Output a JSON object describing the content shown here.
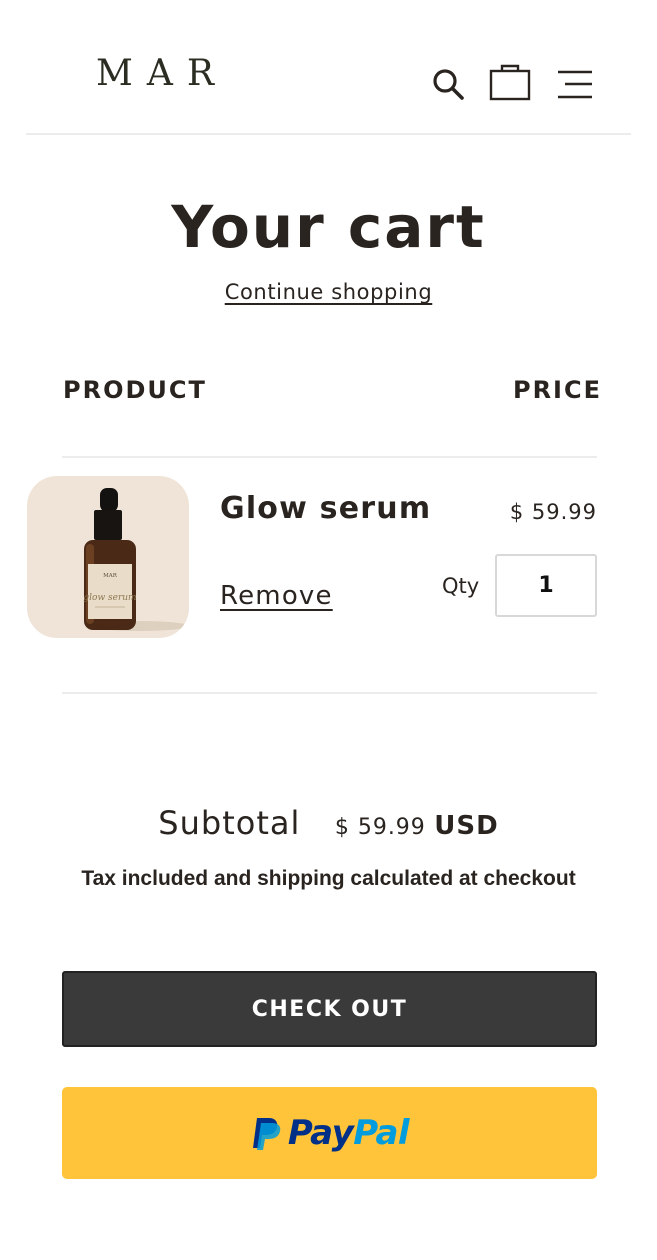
{
  "header": {
    "logo": "MAR",
    "icons": [
      "search-icon",
      "shopping-bag-icon",
      "menu-icon"
    ]
  },
  "cart": {
    "title": "Your cart",
    "continue_label": "Continue shopping",
    "columns": {
      "product": "PRODUCT",
      "price": "PRICE"
    },
    "items": [
      {
        "name": "Glow serum",
        "price": "$ 59.99",
        "remove_label": "Remove",
        "qty_label": "Qty",
        "qty": "1",
        "image": {
          "brand": "MAR",
          "script": "glow serum",
          "bg_color": "#efe4d7"
        }
      }
    ]
  },
  "summary": {
    "subtotal_label": "Subtotal",
    "subtotal_amount": "$ 59.99",
    "currency": "USD",
    "tax_note": "Tax included and shipping calculated at checkout"
  },
  "actions": {
    "checkout_label": "CHECK OUT",
    "paypal_pay": "Pay",
    "paypal_pal": "Pal"
  },
  "colors": {
    "text": "#2a2420",
    "checkout_bg": "#3a3a3a",
    "paypal_yellow": "#ffc439",
    "paypal_dark_blue": "#003087",
    "paypal_light_blue": "#009cde"
  }
}
